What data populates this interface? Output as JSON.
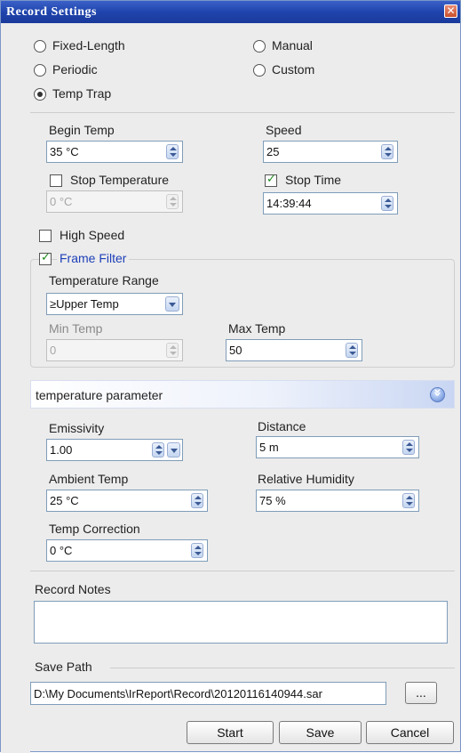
{
  "window": {
    "title": "Record Settings",
    "close_glyph": "✕"
  },
  "mode": {
    "options": [
      {
        "label": "Fixed-Length",
        "checked": false
      },
      {
        "label": "Manual",
        "checked": false
      },
      {
        "label": "Periodic",
        "checked": false
      },
      {
        "label": "Custom",
        "checked": false
      },
      {
        "label": "Temp Trap",
        "checked": true
      }
    ]
  },
  "trap": {
    "begin_temp_label": "Begin Temp",
    "begin_temp_value": "35 °C",
    "speed_label": "Speed",
    "speed_value": "25",
    "stop_temperature_label": "Stop Temperature",
    "stop_temperature_checked": false,
    "stop_temperature_value": "0 °C",
    "stop_time_label": "Stop Time",
    "stop_time_checked": true,
    "stop_time_value": "14:39:44",
    "high_speed_label": "High Speed",
    "high_speed_checked": false
  },
  "frame_filter": {
    "label": "Frame Filter",
    "checked": true,
    "temperature_range_label": "Temperature Range",
    "temperature_range_value": "≥Upper Temp",
    "min_temp_label": "Min Temp",
    "min_temp_value": "0",
    "max_temp_label": "Max Temp",
    "max_temp_value": "50"
  },
  "temperature_parameter": {
    "header": "temperature parameter",
    "emissivity_label": "Emissivity",
    "emissivity_value": "1.00",
    "distance_label": "Distance",
    "distance_value": "5 m",
    "ambient_temp_label": "Ambient Temp",
    "ambient_temp_value": "25 °C",
    "relative_humidity_label": "Relative Humidity",
    "relative_humidity_value": "75 %",
    "temp_correction_label": "Temp Correction",
    "temp_correction_value": "0 °C"
  },
  "notes": {
    "label": "Record Notes",
    "value": ""
  },
  "save": {
    "label": "Save Path",
    "path": "D:\\My Documents\\IrReport\\Record\\20120116140944.sar",
    "browse_label": "..."
  },
  "buttons": {
    "start": "Start",
    "save": "Save",
    "cancel": "Cancel"
  },
  "colors": {
    "title_bar": "#1f44ad",
    "frame_filter_label": "#1e40b8",
    "check_mark": "#1e8a1e"
  }
}
